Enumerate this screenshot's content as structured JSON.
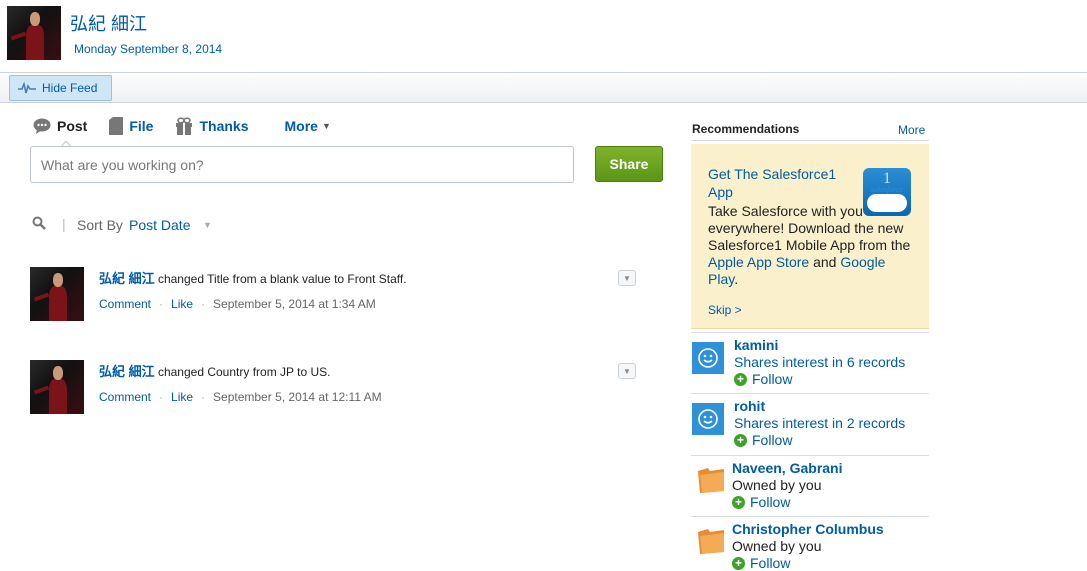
{
  "header": {
    "name": "弘紀 細江",
    "date": "Monday September 8, 2014"
  },
  "feed_bar": {
    "hide_feed_label": "Hide Feed"
  },
  "publisher": {
    "tabs": {
      "post": "Post",
      "file": "File",
      "thanks": "Thanks",
      "more": "More"
    },
    "input_placeholder": "What are you working on?",
    "share_label": "Share"
  },
  "sort": {
    "label": "Sort By",
    "value": "Post Date"
  },
  "feed": [
    {
      "author": "弘紀 細江",
      "text": " changed Title from a blank value to Front Staff.",
      "comment": "Comment",
      "like": "Like",
      "timestamp": "September 5, 2014 at 1:34 AM"
    },
    {
      "author": "弘紀 細江",
      "text": " changed Country from JP to US.",
      "comment": "Comment",
      "like": "Like",
      "timestamp": "September 5, 2014 at 12:11 AM"
    }
  ],
  "recommendations": {
    "title": "Recommendations",
    "more": "More",
    "promo": {
      "title": "Get The Salesforce1 App",
      "body_text": "Take Salesforce with you everywhere! Download the new Salesforce1 Mobile App from the ",
      "app_store": "Apple App Store",
      "and": " and ",
      "google_play": "Google Play",
      "period": ".",
      "skip": "Skip >",
      "logo_text": "salesforce",
      "logo_number": "1"
    },
    "items": [
      {
        "name": "kamini",
        "desc": "Shares interest in 6 records",
        "follow": "Follow",
        "icon": "user-face-icon"
      },
      {
        "name": "rohit",
        "desc": "Shares interest in 2 records",
        "follow": "Follow",
        "icon": "user-face-icon"
      },
      {
        "name": "Naveen, Gabrani",
        "desc": "Owned by you",
        "follow": "Follow",
        "icon": "folder-icon"
      },
      {
        "name": "Christopher Columbus",
        "desc": "Owned by you",
        "follow": "Follow",
        "icon": "folder-icon"
      }
    ]
  },
  "colors": {
    "link": "#015ba7",
    "share_button": "#6aa51f",
    "promo_background": "#fbf0cc",
    "follow_plus": "#3ea22a",
    "user_icon": "#2f91d8",
    "folder_icon": "#f0a04b"
  }
}
